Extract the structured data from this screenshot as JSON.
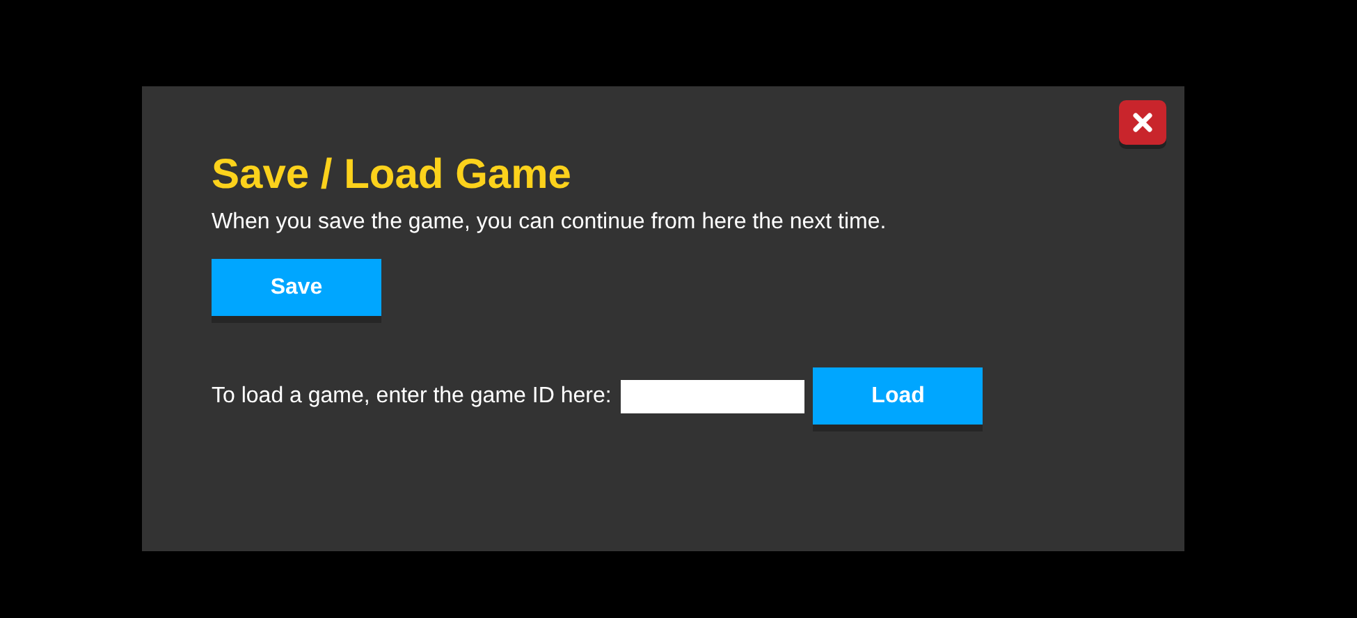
{
  "dialog": {
    "title": "Save / Load Game",
    "description": "When you save the game, you can continue from here the next time.",
    "save_button": "Save",
    "load_prompt": "To load a game, enter the game ID here:",
    "load_button": "Load"
  }
}
